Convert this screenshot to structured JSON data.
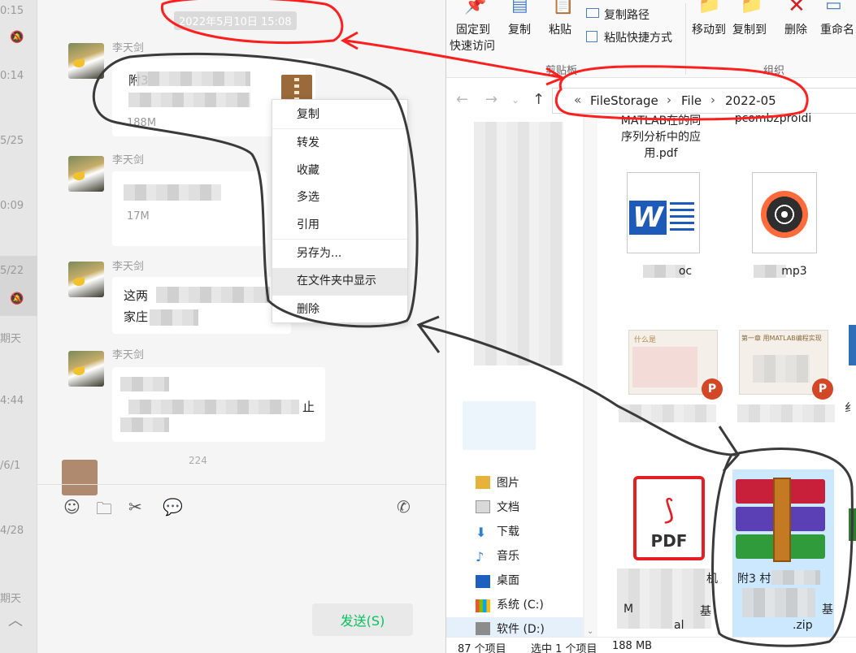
{
  "sessions": {
    "times": [
      "0:15",
      "0:14",
      "5/25",
      "0:09",
      "5/22",
      "期天",
      "4:44",
      "/6/1",
      "4/28",
      "期天"
    ]
  },
  "chat": {
    "timestamp": "2022年5月10日 15:08",
    "messages": [
      {
        "sender": "李天剑",
        "text_visible": "附3",
        "size": "188M"
      },
      {
        "sender": "李天剑",
        "size": "17M"
      },
      {
        "sender": "李天剑",
        "text_line1": "这两",
        "text_line2": "家庄"
      },
      {
        "sender": "李天剑",
        "text_tail": "止"
      }
    ],
    "partial_num": "224",
    "send_label": "发送(S)"
  },
  "context_menu": {
    "items": [
      "复制",
      "转发",
      "收藏",
      "多选",
      "引用",
      "另存为...",
      "在文件夹中显示",
      "删除"
    ],
    "highlighted_index": 6
  },
  "explorer": {
    "ribbon": {
      "pin_line1": "固定到",
      "pin_line2": "快速访问",
      "copy": "复制",
      "paste": "粘贴",
      "copy_path": "复制路径",
      "paste_shortcut": "粘贴快捷方式",
      "move_to": "移动到",
      "copy_to": "复制到",
      "delete": "删除",
      "rename": "重命名",
      "group_clipboard": "剪贴板",
      "group_organize": "组织"
    },
    "address": {
      "overflow": "«",
      "crumbs": [
        "FileStorage",
        "File",
        "2022-05"
      ]
    },
    "nav_items": [
      "图片",
      "文档",
      "下载",
      "音乐",
      "桌面",
      "系统 (C:)",
      "软件 (D:)"
    ],
    "files": {
      "top_cut_1": "MATLAB在的同",
      "top_cut_2": "pcombzproidi",
      "pdf_line1": "序列分析中的应",
      "pdf_line2": "用.pdf",
      "doc_suffix": "oc",
      "mp3_suffix": "mp3",
      "ppt1_title": "什么是",
      "ppt2_title": "第一章 用MATLAB编程实现",
      "pdf2_partial_1": "机",
      "pdf2_partial_2": "M",
      "pdf2_partial_3": "基",
      "pdf2_partial_4": "al",
      "zip_line1": "附3 村",
      "zip_line2": ".zip",
      "zip_partial": "基",
      "side_partial": "纟"
    },
    "status": {
      "count": "87 个项目",
      "selection": "选中 1 个项目",
      "size": "188 MB"
    }
  },
  "colors": {
    "send_green": "#07c160",
    "annotation_red": "#ff1f1f",
    "annotation_dark": "#3a3a3a",
    "selection_blue": "#cce8ff"
  }
}
